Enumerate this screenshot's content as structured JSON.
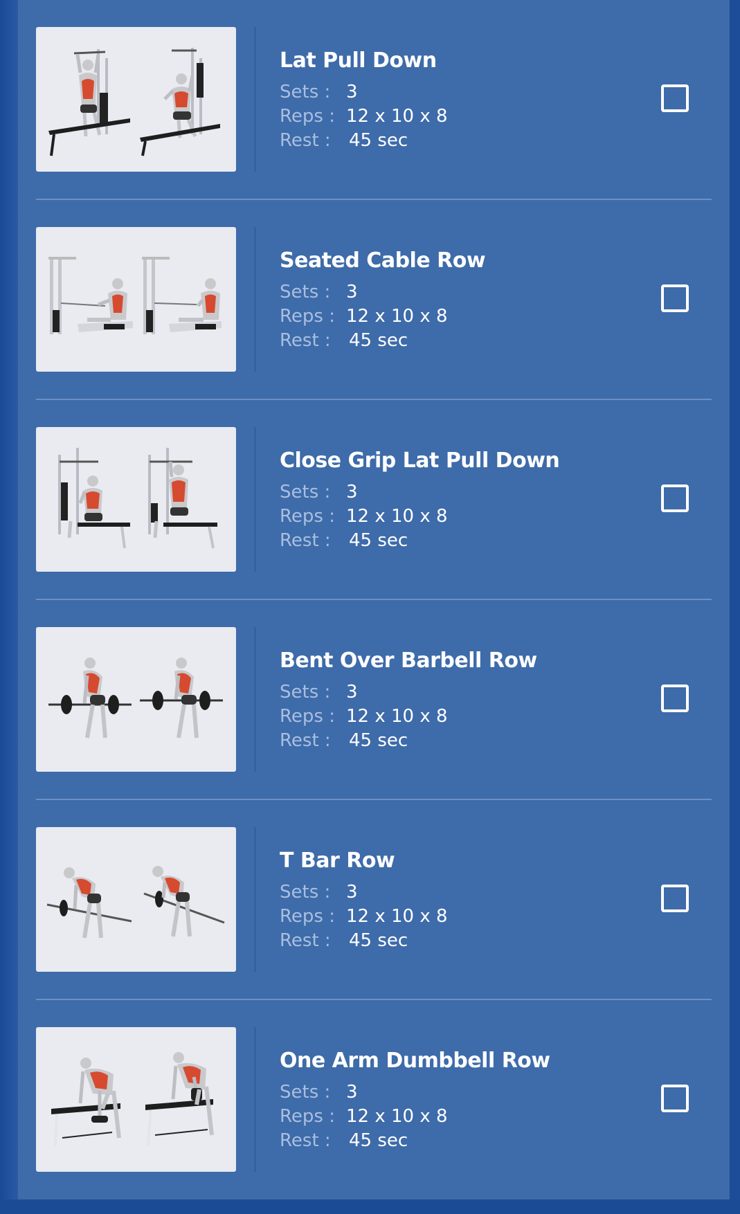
{
  "labels": {
    "sets": "Sets :",
    "reps": "Reps :",
    "rest": "Rest :"
  },
  "colors": {
    "background": "#1f4f9a",
    "panel": "#3e6ba9",
    "divider": "#6c90c4",
    "label": "#a9bfdf",
    "value": "#ffffff",
    "thumbnail_bg": "#e9ebf0"
  },
  "exercises": [
    {
      "name": "Lat Pull Down",
      "sets": "3",
      "reps": "12 x 10 x 8",
      "rest": "45 sec",
      "image": "lat-pull-down-illustration",
      "checked": false
    },
    {
      "name": "Seated Cable Row",
      "sets": "3",
      "reps": "12 x 10 x 8",
      "rest": "45 sec",
      "image": "seated-cable-row-illustration",
      "checked": false
    },
    {
      "name": "Close Grip Lat Pull Down",
      "sets": "3",
      "reps": "12 x 10 x 8",
      "rest": "45 sec",
      "image": "close-grip-lat-pull-down-illustration",
      "checked": false
    },
    {
      "name": "Bent Over Barbell Row",
      "sets": "3",
      "reps": "12 x 10 x 8",
      "rest": "45 sec",
      "image": "bent-over-barbell-row-illustration",
      "checked": false
    },
    {
      "name": "T Bar Row",
      "sets": "3",
      "reps": "12 x 10 x 8",
      "rest": "45 sec",
      "image": "t-bar-row-illustration",
      "checked": false
    },
    {
      "name": "One Arm Dumbbell Row",
      "sets": "3",
      "reps": "12 x 10 x 8",
      "rest": "45 sec",
      "image": "one-arm-dumbbell-row-illustration",
      "checked": false
    }
  ]
}
